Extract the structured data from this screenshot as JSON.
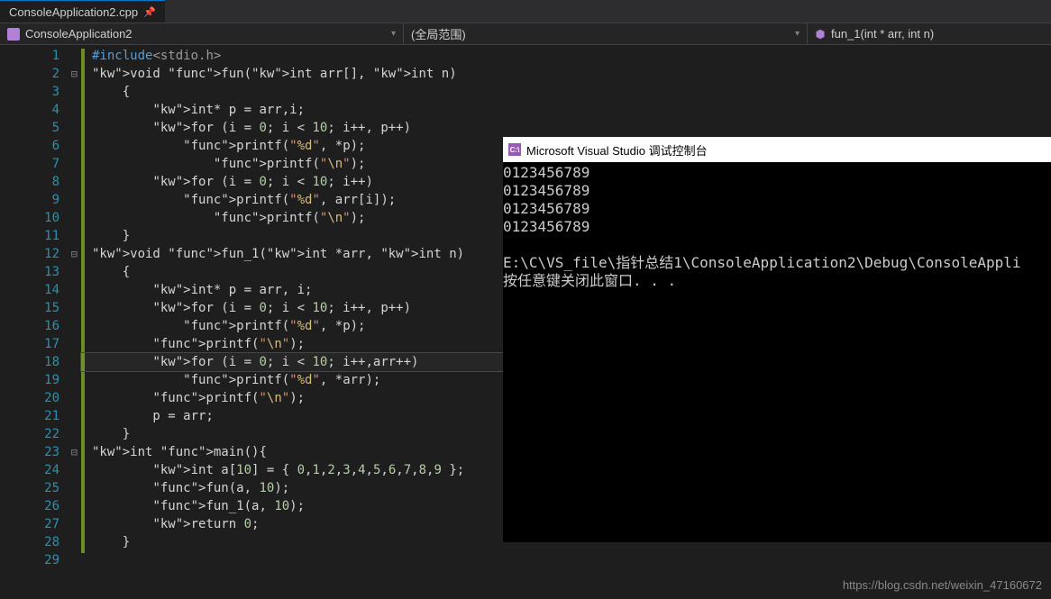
{
  "tab": {
    "label": "ConsoleApplication2.cpp",
    "pin": "📌"
  },
  "navbar": {
    "left": "ConsoleApplication2",
    "mid": "(全局范围)",
    "right": "fun_1(int * arr, int n)"
  },
  "gutter": {
    "count": 29,
    "folds": [
      2,
      12,
      23
    ]
  },
  "code": [
    {
      "t": "#include<stdio.h>",
      "cls": "preproc"
    },
    {
      "t": "void fun(int arr[], int n)"
    },
    {
      "t": "    {"
    },
    {
      "t": "        int* p = arr,i;"
    },
    {
      "t": "        for (i = 0; i < 10; i++, p++)"
    },
    {
      "t": "            printf(\"%d\", *p);"
    },
    {
      "t": "                printf(\"\\n\");"
    },
    {
      "t": "        for (i = 0; i < 10; i++)"
    },
    {
      "t": "            printf(\"%d\", arr[i]);"
    },
    {
      "t": "                printf(\"\\n\");"
    },
    {
      "t": "    }"
    },
    {
      "t": "void fun_1(int *arr, int n)"
    },
    {
      "t": "    {"
    },
    {
      "t": "        int* p = arr, i;"
    },
    {
      "t": "        for (i = 0; i < 10; i++, p++)"
    },
    {
      "t": "            printf(\"%d\", *p);"
    },
    {
      "t": "        printf(\"\\n\");"
    },
    {
      "t": "        for (i = 0; i < 10; i++,arr++)",
      "current": true
    },
    {
      "t": "            printf(\"%d\", *arr);"
    },
    {
      "t": "        printf(\"\\n\");"
    },
    {
      "t": "        p = arr;"
    },
    {
      "t": "    }"
    },
    {
      "t": "int main(){"
    },
    {
      "t": "        int a[10] = { 0,1,2,3,4,5,6,7,8,9 };"
    },
    {
      "t": "        fun(a, 10);"
    },
    {
      "t": "        fun_1(a, 10);"
    },
    {
      "t": "        return 0;"
    },
    {
      "t": "    }"
    },
    {
      "t": ""
    }
  ],
  "console": {
    "title": "Microsoft Visual Studio 调试控制台",
    "lines": [
      "0123456789",
      "0123456789",
      "0123456789",
      "0123456789",
      "",
      "E:\\C\\VS_file\\指针总结1\\ConsoleApplication2\\Debug\\ConsoleAppli",
      "按任意键关闭此窗口. . ."
    ]
  },
  "watermark": "https://blog.csdn.net/weixin_47160672"
}
